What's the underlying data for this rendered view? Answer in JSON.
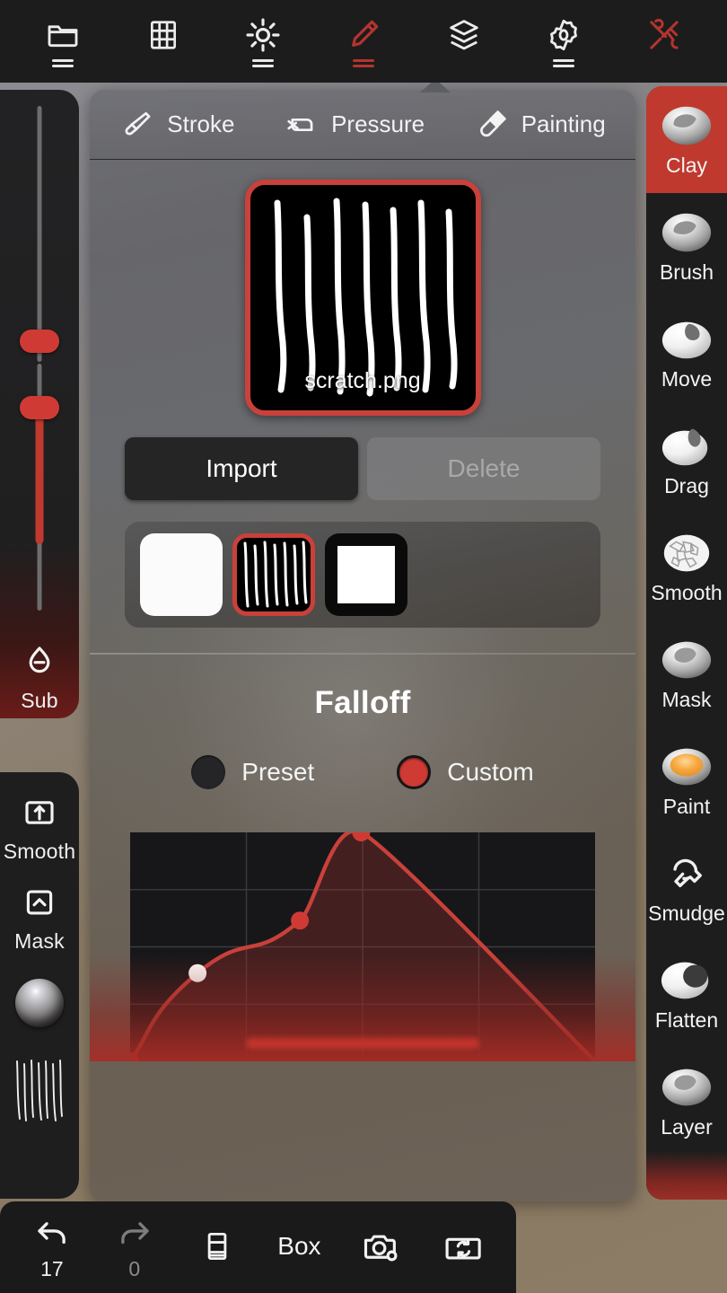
{
  "colors": {
    "accent_red": "#c0392f",
    "bright_red": "#cf3b34",
    "panel_dark": "#1d1d1e",
    "toolbar_bg": "#1c1c1c",
    "background_tan": "#8a7a66"
  },
  "topbar": {
    "items": [
      {
        "name": "folder-icon",
        "label": "Files",
        "icon": "folder-icon",
        "active": false,
        "has_dash": true
      },
      {
        "name": "grid-icon",
        "label": "Grid",
        "icon": "grid-icon",
        "active": false,
        "has_dash": false
      },
      {
        "name": "lighting-icon",
        "label": "Lighting",
        "icon": "sun-icon",
        "active": false,
        "has_dash": true
      },
      {
        "name": "brush-icon",
        "label": "Brush",
        "icon": "pencil-icon",
        "active": true,
        "has_dash": true
      },
      {
        "name": "layers-icon",
        "label": "Layers",
        "icon": "layers-icon",
        "active": false,
        "has_dash": false
      },
      {
        "name": "settings-icon",
        "label": "Settings",
        "icon": "gear-icon",
        "active": false,
        "has_dash": true
      },
      {
        "name": "tools-icon",
        "label": "Tools",
        "icon": "tools-icon",
        "active": true,
        "has_dash": false
      }
    ]
  },
  "left_sidebar": {
    "sliders": [
      {
        "name": "size-slider",
        "value_pct": 52
      },
      {
        "name": "strength-slider",
        "value_pct": 62
      }
    ],
    "buttons": [
      {
        "name": "sub-button",
        "label": "Sub",
        "icon": "droplet-minus-icon"
      },
      {
        "name": "smooth-button",
        "label": "Smooth",
        "icon": "box-up-arrow-icon"
      },
      {
        "name": "mask-button",
        "label": "Mask",
        "icon": "box-chevron-up-icon"
      }
    ],
    "material_chip": {
      "name": "material-sphere",
      "icon": "metal-sphere-icon"
    },
    "texture_chip": {
      "name": "texture-chip",
      "icon": "scratch-lines-icon"
    }
  },
  "right_sidebar": {
    "items": [
      {
        "label": "Clay",
        "selected": true,
        "style": "clay"
      },
      {
        "label": "Brush",
        "selected": false,
        "style": "clay"
      },
      {
        "label": "Move",
        "selected": false,
        "style": "move"
      },
      {
        "label": "Drag",
        "selected": false,
        "style": "drag"
      },
      {
        "label": "Smooth",
        "selected": false,
        "style": "smooth"
      },
      {
        "label": "Mask",
        "selected": false,
        "style": "mask"
      },
      {
        "label": "Paint",
        "selected": false,
        "style": "paint"
      },
      {
        "label": "Smudge",
        "selected": false,
        "style": "smudge"
      },
      {
        "label": "Flatten",
        "selected": false,
        "style": "flatten"
      },
      {
        "label": "Layer",
        "selected": false,
        "style": "layer"
      }
    ]
  },
  "panel": {
    "tabs": [
      {
        "label": "Stroke",
        "icon": "brush-tip-icon",
        "active": false
      },
      {
        "label": "Pressure",
        "icon": "pressure-hand-icon",
        "active": false
      },
      {
        "label": "Painting",
        "icon": "paint-brush-icon",
        "active": false
      }
    ],
    "texture": {
      "preview_name": "scratch.png",
      "import_label": "Import",
      "delete_label": "Delete",
      "delete_enabled": false,
      "thumbnails": [
        {
          "name": "texture-thumb-white",
          "kind": "plain-white",
          "selected": false
        },
        {
          "name": "texture-thumb-scratch",
          "kind": "scratch",
          "selected": true
        },
        {
          "name": "texture-thumb-square",
          "kind": "framed",
          "selected": false
        }
      ]
    },
    "falloff": {
      "title": "Falloff",
      "mode_options": [
        {
          "label": "Preset",
          "selected": false
        },
        {
          "label": "Custom",
          "selected": true
        }
      ]
    }
  },
  "chart_data": {
    "type": "line",
    "title": "Falloff",
    "xlabel": "",
    "ylabel": "",
    "xlim": [
      0,
      1
    ],
    "ylim": [
      0,
      1
    ],
    "grid": true,
    "grid_cols": 4,
    "grid_rows": 4,
    "legend": "none",
    "series": [
      {
        "name": "falloff-curve",
        "points": [
          {
            "x": 0.0,
            "y": 0.0,
            "handle": "red"
          },
          {
            "x": 0.145,
            "y": 0.385,
            "handle": "white"
          },
          {
            "x": 0.365,
            "y": 0.615,
            "handle": "red"
          },
          {
            "x": 0.497,
            "y": 1.0,
            "handle": "red"
          },
          {
            "x": 1.0,
            "y": 0.0,
            "handle": "none"
          }
        ],
        "line_color": "#c8413a",
        "fill_color": "rgba(170,50,45,0.30)"
      }
    ]
  },
  "bottombar": {
    "items": [
      {
        "name": "undo-button",
        "icon": "undo-arrow-icon",
        "count": "17",
        "dim": false,
        "kind": "count"
      },
      {
        "name": "redo-button",
        "icon": "redo-arrow-icon",
        "count": "0",
        "dim": true,
        "kind": "count"
      },
      {
        "name": "book-button",
        "icon": "book-icon",
        "kind": "icon"
      },
      {
        "name": "box-button",
        "label": "Box",
        "kind": "text"
      },
      {
        "name": "camera-search-button",
        "icon": "camera-search-icon",
        "kind": "icon"
      },
      {
        "name": "camera-flip-button",
        "icon": "camera-flip-icon",
        "kind": "icon"
      }
    ]
  }
}
